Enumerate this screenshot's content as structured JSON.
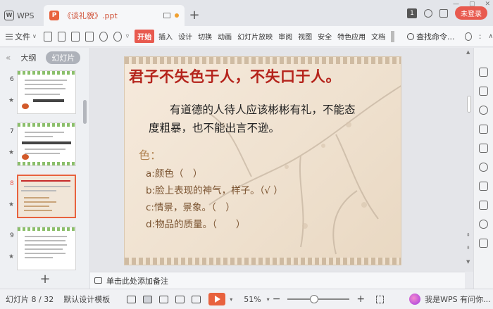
{
  "titlebar": {
    "wps_label": "WPS",
    "doc_tab_name": "《谈礼貌》.ppt",
    "counter_badge": "1",
    "login_label": "未登录"
  },
  "toolbar": {
    "file_label": "文件",
    "tabs": [
      "开始",
      "插入",
      "设计",
      "切换",
      "动画",
      "幻灯片放映",
      "审阅",
      "视图",
      "安全",
      "特色应用",
      "文档"
    ],
    "active_tab": "开始",
    "search_label": "查找命令..."
  },
  "leftpanel": {
    "tab_outline": "大纲",
    "tab_slides": "幻灯片",
    "thumbs": [
      {
        "num": "6",
        "star": "★"
      },
      {
        "num": "7",
        "star": "★"
      },
      {
        "num": "8",
        "star": "★"
      },
      {
        "num": "9",
        "star": "★"
      }
    ],
    "add_label": "+"
  },
  "slide": {
    "title": "君子不失色于人，不失口于人。",
    "para_line1": "有道德的人待人应该彬彬有礼，不能态",
    "para_line2": "度粗暴，也不能出言不逊。",
    "subhead": "色：",
    "items": [
      "a:颜色（　）",
      "b:脸上表现的神气，样子。（√ ）",
      "c:情景，景象。（　）",
      "d:物品的质量。（　　）"
    ]
  },
  "notes": {
    "placeholder": "单击此处添加备注"
  },
  "statusbar": {
    "slide_counter": "幻灯片 8 / 32",
    "template": "默认设计模板",
    "zoom": "51%",
    "helper": "我是WPS 有问你..."
  },
  "colors": {
    "accent": "#e85a4f",
    "slide_title": "#b5241c",
    "list_text": "#7a5330"
  }
}
